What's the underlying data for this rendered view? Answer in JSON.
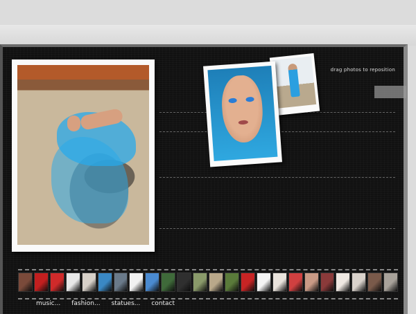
{
  "hint": "drag photos to reposition",
  "nav": {
    "items": [
      "music...",
      "fashion...",
      "statues...",
      "contact"
    ]
  },
  "filmstrip": {
    "thumbs": [
      {
        "icon": "photo-thumb",
        "color": "#7a4a3a"
      },
      {
        "icon": "photo-thumb",
        "color": "#c21f1f"
      },
      {
        "icon": "photo-thumb",
        "color": "#d02a2a"
      },
      {
        "icon": "photo-thumb",
        "color": "#e8e8e8"
      },
      {
        "icon": "photo-thumb",
        "color": "#d7d0c8"
      },
      {
        "icon": "photo-thumb",
        "color": "#3a88c4"
      },
      {
        "icon": "photo-thumb",
        "color": "#6a7a8a"
      },
      {
        "icon": "photo-thumb",
        "color": "#f2f2f2"
      },
      {
        "icon": "photo-thumb",
        "color": "#4a8ad0"
      },
      {
        "icon": "photo-thumb",
        "color": "#3f6a3a"
      },
      {
        "icon": "photo-thumb",
        "color": "#2f2f2f"
      },
      {
        "icon": "photo-thumb",
        "color": "#8a9a6a"
      },
      {
        "icon": "photo-thumb",
        "color": "#b9a88a"
      },
      {
        "icon": "photo-thumb",
        "color": "#5a7a3a"
      },
      {
        "icon": "photo-thumb",
        "color": "#c72424"
      },
      {
        "icon": "photo-thumb",
        "color": "#f4f4f4"
      },
      {
        "icon": "photo-thumb",
        "color": "#e9e3dc"
      },
      {
        "icon": "photo-thumb",
        "color": "#d04040"
      },
      {
        "icon": "photo-thumb",
        "color": "#c99a86"
      },
      {
        "icon": "photo-thumb",
        "color": "#8a3a3a"
      },
      {
        "icon": "photo-thumb",
        "color": "#efe8e2"
      },
      {
        "icon": "photo-thumb",
        "color": "#d9d2cb"
      },
      {
        "icon": "photo-thumb",
        "color": "#7a5a4a"
      },
      {
        "icon": "photo-thumb",
        "color": "#a8a29a"
      }
    ]
  }
}
